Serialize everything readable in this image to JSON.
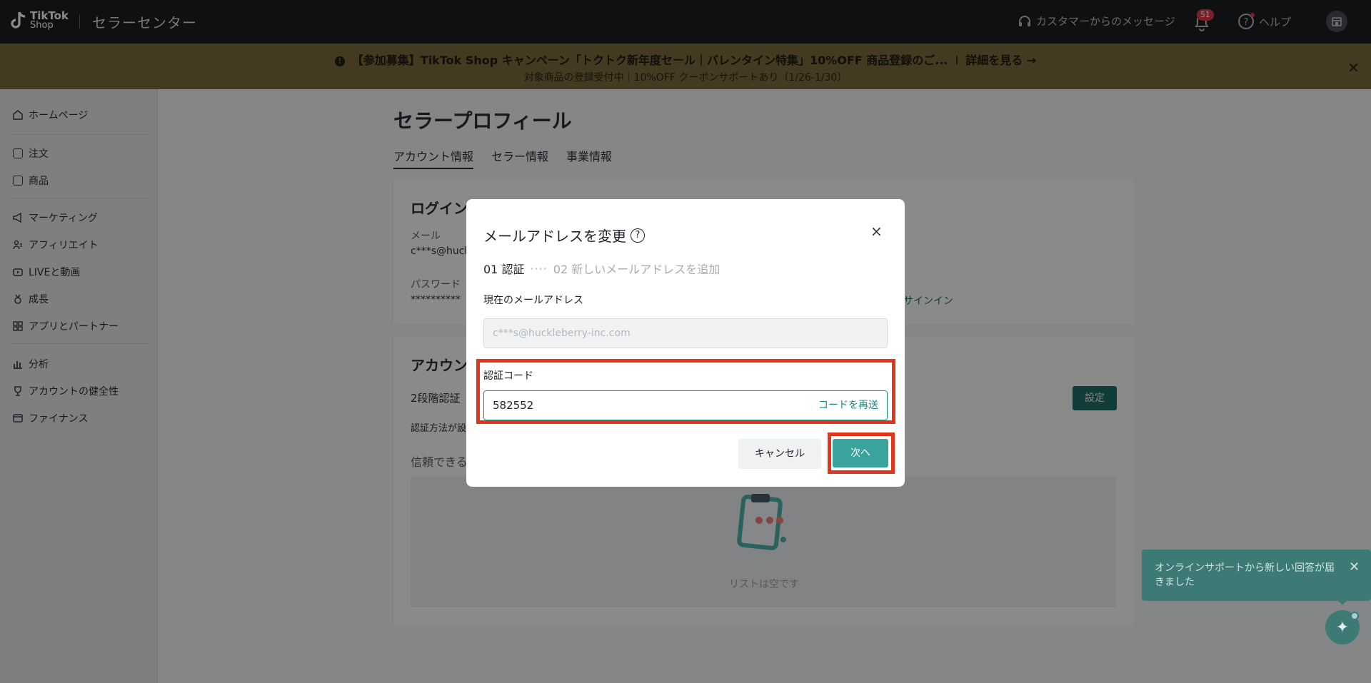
{
  "topbar": {
    "logo_line1": "TikTok",
    "logo_line2": "Shop",
    "app_title": "セラーセンター",
    "messages_label": "カスタマーからのメッセージ",
    "notification_count": "51",
    "help_label": "ヘルプ"
  },
  "banner": {
    "info_icon": "!",
    "text": "【参加募集】TikTok Shop キャンペーン「トクトク新年度セール｜バレンタイン特集」10%OFF 商品登録のご...",
    "separator": "I",
    "link": "詳細を見る →",
    "subtext": "対象商品の登録受付中｜10%OFF クーポンサポートあり（1/26-1/30）",
    "close": "✕"
  },
  "sidebar": {
    "items": [
      {
        "label": "ホームページ",
        "icon": "home-icon"
      },
      {
        "label": "注文",
        "icon": "clipboard-icon"
      },
      {
        "label": "商品",
        "icon": "box-icon"
      },
      {
        "label": "マーケティング",
        "icon": "megaphone-icon"
      },
      {
        "label": "アフィリエイト",
        "icon": "users-icon"
      },
      {
        "label": "LIVEと動画",
        "icon": "video-icon"
      },
      {
        "label": "成長",
        "icon": "medal-icon"
      },
      {
        "label": "アプリとパートナー",
        "icon": "grid-icon"
      },
      {
        "label": "分析",
        "icon": "bar-chart-icon"
      },
      {
        "label": "アカウントの健全性",
        "icon": "trophy-icon"
      },
      {
        "label": "ファイナンス",
        "icon": "wallet-icon"
      }
    ]
  },
  "main": {
    "title": "セラープロフィール",
    "tabs": [
      "アカウント情報",
      "セラー情報",
      "事業情報"
    ],
    "login_card": {
      "heading": "ログイン",
      "email_label": "メール",
      "email_value": "c***s@huck",
      "password_label": "パスワード",
      "password_value": "**********",
      "signin_link": "サインイン"
    },
    "account_card": {
      "heading": "アカウン",
      "two_factor_label": "2段階認証",
      "method_text": "認証方法が設",
      "trusted_label": "信頼できる",
      "set_button": "設定",
      "empty_text": "リストは空です"
    }
  },
  "modal": {
    "title": "メールアドレスを変更",
    "help_glyph": "?",
    "close": "×",
    "step1": "01 認証",
    "step_dots": "····",
    "step2": "02 新しいメールアドレスを追加",
    "current_email_label": "現在のメールアドレス",
    "current_email_value": "c***s@huckleberry-inc.com",
    "code_label": "認証コード",
    "code_value": "582552",
    "resend_label": "コードを再送",
    "cancel_label": "キャンセル",
    "next_label": "次へ"
  },
  "toast": {
    "text": "オンラインサポートから新しい回答が届きました",
    "close": "✕"
  },
  "fab": {
    "glyph": "✦"
  }
}
